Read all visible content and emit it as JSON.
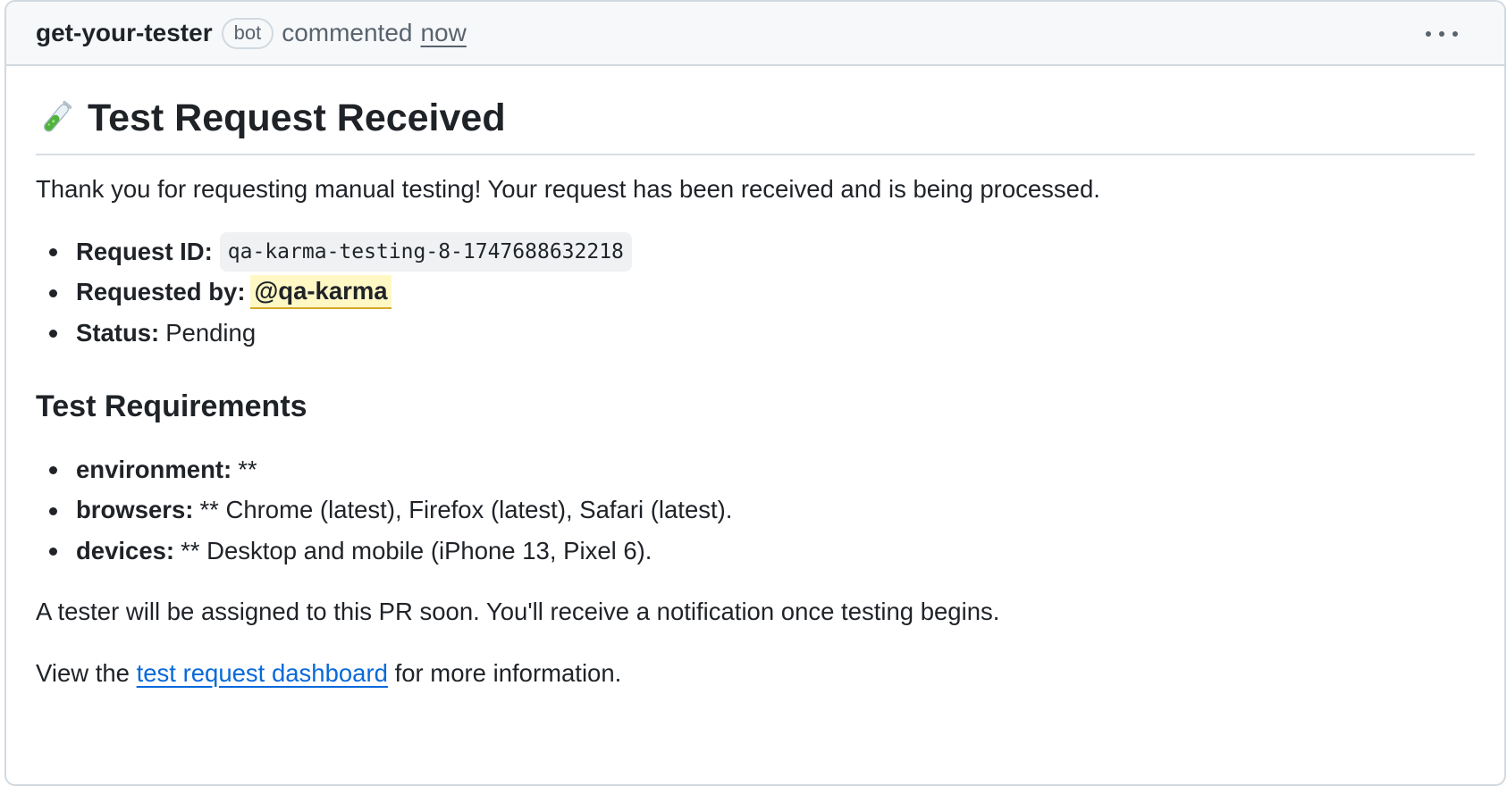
{
  "header": {
    "author": "get-your-tester",
    "badge": "bot",
    "action": "commented",
    "time": "now"
  },
  "comment": {
    "title": "Test Request Received",
    "title_icon": "test-tube-icon",
    "intro": "Thank you for requesting manual testing! Your request has been received and is being processed.",
    "meta": {
      "request_id_label": "Request ID:",
      "request_id": "qa-karma-testing-8-1747688632218",
      "requested_by_label": "Requested by:",
      "requested_by": "@qa-karma",
      "status_label": "Status:",
      "status": "Pending"
    },
    "requirements_heading": "Test Requirements",
    "requirements": [
      {
        "label": "environment:",
        "value": "**"
      },
      {
        "label": "browsers:",
        "value": "** Chrome (latest), Firefox (latest), Safari (latest)."
      },
      {
        "label": "devices:",
        "value": "** Desktop and mobile (iPhone 13, Pixel 6)."
      }
    ],
    "assignment_note": "A tester will be assigned to this PR soon. You'll receive a notification once testing begins.",
    "footer_prefix": "View the",
    "footer_link": "test request dashboard",
    "footer_suffix": "for more information."
  },
  "colors": {
    "link": "#0969da",
    "mention_bg": "#fff8c5",
    "header_bg": "#f6f8fa",
    "border": "#d1d9e0"
  }
}
